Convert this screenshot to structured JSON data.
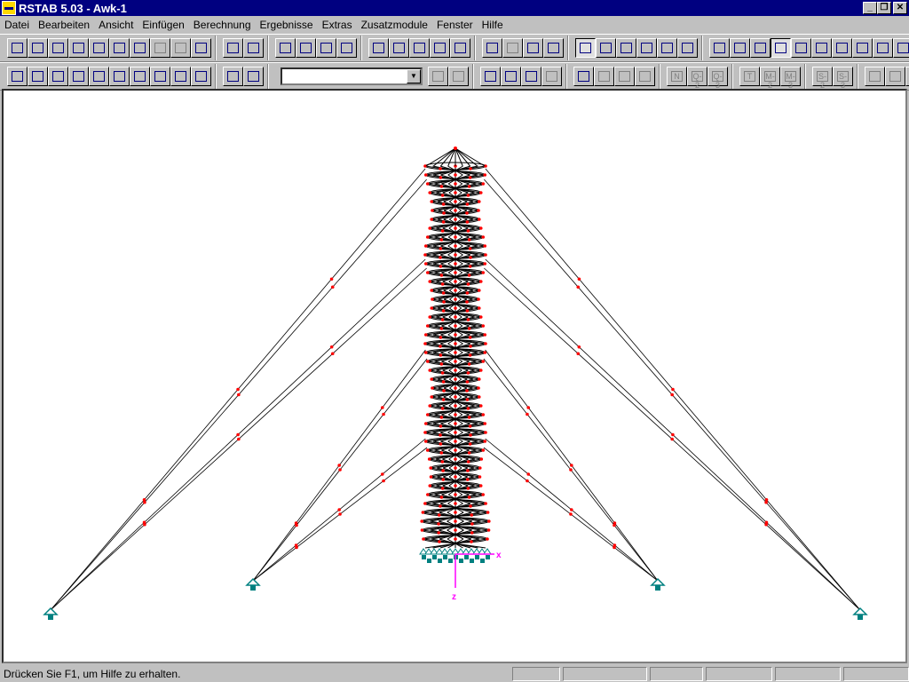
{
  "title": "RSTAB 5.03 - Awk-1",
  "menu": [
    "Datei",
    "Bearbeiten",
    "Ansicht",
    "Einfügen",
    "Berechnung",
    "Ergebnisse",
    "Extras",
    "Zusatzmodule",
    "Fenster",
    "Hilfe"
  ],
  "toolbar1": [
    [
      "new-file",
      "open-folder",
      "open-project",
      "save",
      "save-all",
      "print",
      "book",
      "undo",
      "redo",
      "help"
    ],
    [
      "select",
      "add-member"
    ],
    [
      "pan-hand",
      "zoom",
      "zoom-window",
      "zoom-all"
    ],
    [
      "view-x",
      "view-y",
      "view-z",
      "view-iso",
      "view-3d"
    ],
    [
      "cross-section",
      "material",
      "support",
      "hinge"
    ],
    [
      "window-cascade",
      "window-horizontal",
      "window-vertical",
      "window-split",
      "window-single",
      "window-arrange"
    ],
    [
      "grid",
      "dot-grid",
      "snap",
      "render-solid",
      "render-members",
      "render-colored",
      "dimensions",
      "node-cross",
      "find",
      "glasses"
    ]
  ],
  "toolbar2": [
    [
      "table",
      "new-node",
      "new-member",
      "new-frame",
      "new-support",
      "new-load",
      "new-set",
      "new-hinge",
      "new-dimension",
      "new-text"
    ],
    [
      "import",
      "export"
    ],
    [
      "prev",
      "next"
    ],
    [
      "member-loads",
      "nodal-loads",
      "deformation",
      "results-table"
    ],
    [
      "result-frame",
      "result-arch",
      "result-mass",
      "result-node"
    ],
    [
      "N",
      "Q-2",
      "Q-3"
    ],
    [
      "T",
      "M-2",
      "M-3"
    ],
    [
      "S-2",
      "S-3"
    ],
    [
      "balance",
      "grid-table",
      "hatch"
    ]
  ],
  "disabled": [
    "undo",
    "redo",
    "prev",
    "next",
    "material",
    "result-arch",
    "result-mass",
    "result-node",
    "N",
    "Q-2",
    "Q-3",
    "T",
    "M-2",
    "M-3",
    "S-2",
    "S-3",
    "balance",
    "grid-table",
    "hatch",
    "results-table"
  ],
  "active": [
    "window-cascade",
    "render-solid"
  ],
  "combo_value": "",
  "axis": {
    "x": "x",
    "z": "z"
  },
  "colors": {
    "nodes": "#ff0000",
    "members": "#000000",
    "supports": "#008080",
    "axes": "#ff00ff"
  },
  "status": "Drücken Sie F1, um Hilfe zu erhalten."
}
